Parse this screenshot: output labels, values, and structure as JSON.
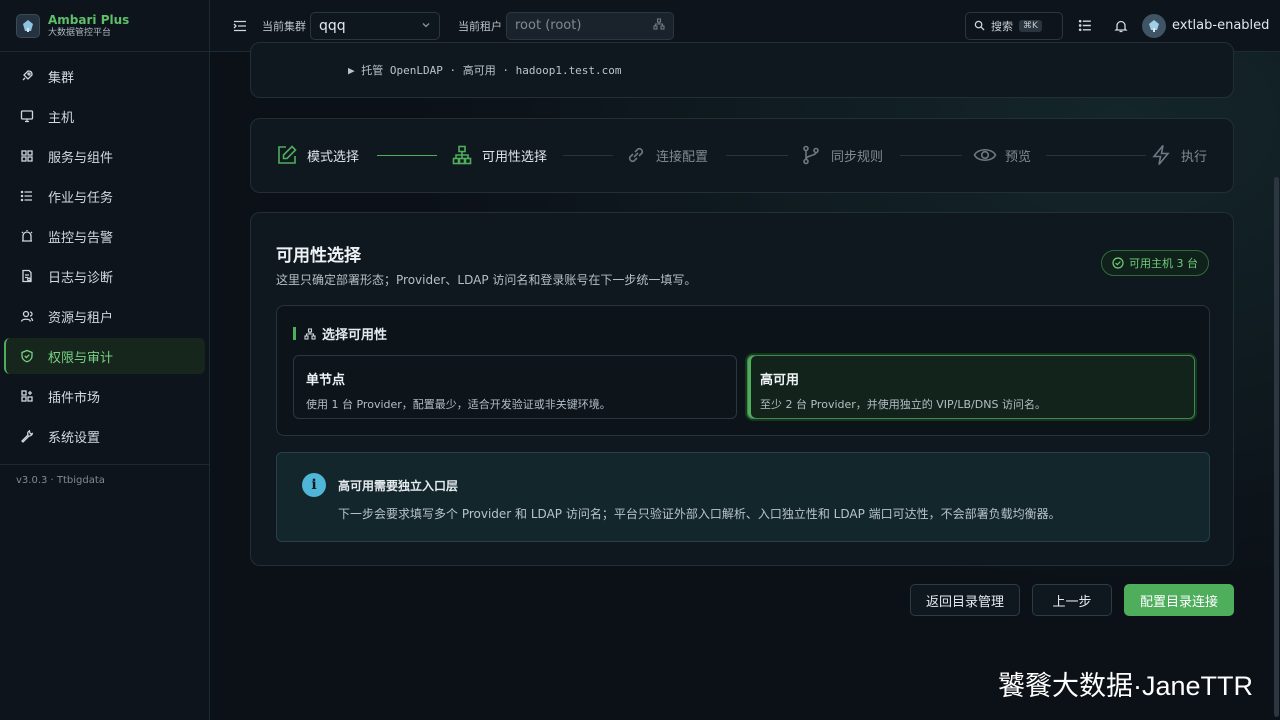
{
  "brand": {
    "name": "Ambari Plus",
    "subtitle": "大数据管控平台"
  },
  "sidebar": {
    "items": [
      {
        "label": "集群",
        "icon": "rocket-icon"
      },
      {
        "label": "主机",
        "icon": "monitor-icon"
      },
      {
        "label": "服务与组件",
        "icon": "grid-icon"
      },
      {
        "label": "作业与任务",
        "icon": "list-icon"
      },
      {
        "label": "监控与告警",
        "icon": "alarm-icon"
      },
      {
        "label": "日志与诊断",
        "icon": "log-icon"
      },
      {
        "label": "资源与租户",
        "icon": "users-icon"
      },
      {
        "label": "权限与审计",
        "icon": "shield-icon",
        "active": true
      },
      {
        "label": "插件市场",
        "icon": "plugin-icon"
      },
      {
        "label": "系统设置",
        "icon": "wrench-icon"
      }
    ],
    "version": "v3.0.3 · Ttbigdata"
  },
  "topbar": {
    "cluster_label": "当前集群",
    "cluster_value": "qqq",
    "tenant_label": "当前租户",
    "tenant_value": "root (root)",
    "search_label": "搜索",
    "search_shortcut": "⌘K",
    "username": "extlab-enabled"
  },
  "summary": {
    "line": "▶ 托管 OpenLDAP · 高可用 · hadoop1.test.com"
  },
  "stepper": {
    "steps": [
      {
        "label": "模式选择",
        "state": "done",
        "icon": "edit-icon"
      },
      {
        "label": "可用性选择",
        "state": "current",
        "icon": "hierarchy-icon"
      },
      {
        "label": "连接配置",
        "state": "pending",
        "icon": "link-icon"
      },
      {
        "label": "同步规则",
        "state": "pending",
        "icon": "branch-icon"
      },
      {
        "label": "预览",
        "state": "pending",
        "icon": "eye-icon"
      },
      {
        "label": "执行",
        "state": "pending",
        "icon": "bolt-icon"
      }
    ]
  },
  "panel": {
    "title": "可用性选择",
    "description": "这里只确定部署形态；Provider、LDAP 访问名和登录账号在下一步统一填写。",
    "badge": "可用主机 3 台",
    "section_title": "选择可用性",
    "options": [
      {
        "title": "单节点",
        "description": "使用 1 台 Provider，配置最少，适合开发验证或非关键环境。",
        "selected": false
      },
      {
        "title": "高可用",
        "description": "至少 2 台 Provider，并使用独立的 VIP/LB/DNS 访问名。",
        "selected": true
      }
    ],
    "info_title": "高可用需要独立入口层",
    "info_description": "下一步会要求填写多个 Provider 和 LDAP 访问名；平台只验证外部入口解析、入口独立性和 LDAP 端口可达性，不会部署负载均衡器。",
    "info_icon": "i"
  },
  "actions": {
    "back_to_catalog": "返回目录管理",
    "previous": "上一步",
    "next": "配置目录连接"
  },
  "watermark": "饕餮大数据·JaneTTR",
  "colors": {
    "accent": "#4fae5c",
    "info": "#4fb6d8",
    "background": "#0b1117"
  }
}
